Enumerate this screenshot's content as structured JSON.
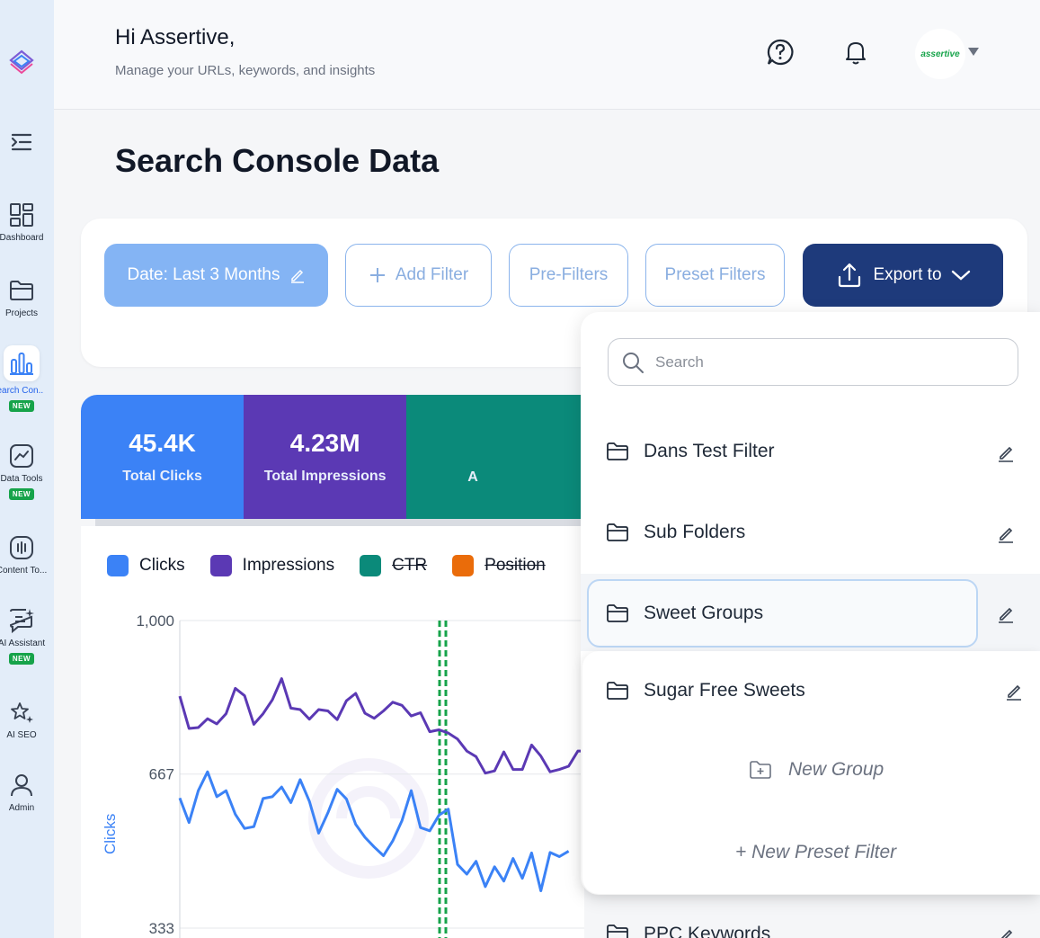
{
  "sidebar": {
    "items": [
      {
        "label": "Dashboard",
        "icon": "dashboard-icon"
      },
      {
        "label": "Projects",
        "icon": "folder-icon"
      },
      {
        "label": "Search Con..",
        "icon": "bar-chart-icon",
        "badge": "NEW",
        "active": true
      },
      {
        "label": "Data Tools",
        "icon": "trend-icon",
        "badge": "NEW"
      },
      {
        "label": "Content To...",
        "icon": "audio-bars-icon"
      },
      {
        "label": "AI Assistant",
        "icon": "chat-sparkle-icon",
        "badge": "NEW"
      },
      {
        "label": "AI SEO",
        "icon": "stars-icon"
      },
      {
        "label": "Admin",
        "icon": "user-icon"
      }
    ]
  },
  "header": {
    "greeting": "Hi Assertive,",
    "subtitle": "Manage your URLs, keywords, and insights",
    "profile_text": "assertive"
  },
  "page": {
    "title": "Search Console Data"
  },
  "filters": {
    "date": "Date: Last 3 Months",
    "add_filter": "Add Filter",
    "pre_filters": "Pre-Filters",
    "preset_filters": "Preset Filters",
    "export": "Export to"
  },
  "stats": [
    {
      "value": "45.4K",
      "label": "Total Clicks",
      "color": "#3b82f6"
    },
    {
      "value": "4.23M",
      "label": "Total Impressions",
      "color": "#5b39b4"
    },
    {
      "value": "",
      "label": "A",
      "color": "#0b8a7a"
    }
  ],
  "legend": [
    {
      "label": "Clicks",
      "color": "#3b82f6",
      "active": true
    },
    {
      "label": "Impressions",
      "color": "#5b39b4",
      "active": true
    },
    {
      "label": "CTR",
      "color": "#0b8a7a",
      "active": false
    },
    {
      "label": "Position",
      "color": "#ea6c0a",
      "active": false
    }
  ],
  "chart_data": {
    "type": "line",
    "ylabel": "Clicks",
    "y_ticks": [
      "1,000",
      "667",
      "333"
    ],
    "ylim": [
      333,
      1000
    ],
    "series": [
      {
        "name": "Impressions",
        "color": "#5b39b4",
        "values": [
          836,
          766,
          768,
          787,
          776,
          798,
          853,
          837,
          775,
          798,
          828,
          874,
          810,
          807,
          786,
          807,
          804,
          785,
          826,
          842,
          799,
          788,
          804,
          823,
          816,
          793,
          800,
          759,
          763,
          756,
          743,
          717,
          705,
          669,
          674,
          715,
          677,
          677,
          730,
          706,
          672,
          677,
          684,
          717,
          717
        ]
      },
      {
        "name": "Clicks",
        "color": "#3b82f6",
        "values": [
          615,
          562,
          631,
          672,
          618,
          631,
          580,
          549,
          553,
          614,
          618,
          639,
          605,
          655,
          608,
          539,
          583,
          634,
          613,
          558,
          530,
          509,
          490,
          522,
          566,
          631,
          551,
          544,
          578,
          591,
          471,
          450,
          478,
          423,
          466,
          435,
          484,
          441,
          496,
          414,
          497,
          488,
          500
        ]
      }
    ],
    "marker_color": "#16a34a"
  },
  "dropdown": {
    "search_placeholder": "Search",
    "items": [
      "Dans Test Filter",
      "Sub Folders",
      "Sweet Groups"
    ],
    "sub_items": [
      "Sugar Free Sweets"
    ],
    "new_group": "New Group",
    "new_preset": "+ New Preset Filter",
    "partial_item": "PPC Keywords"
  }
}
